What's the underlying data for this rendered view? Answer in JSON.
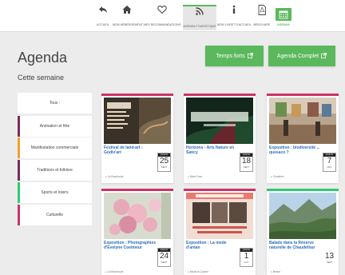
{
  "nav": {
    "items": [
      {
        "label": "ACCUEIL",
        "icon": "undo-arrow-icon"
      },
      {
        "label": "MON HÉBERGEMENT",
        "icon": "house-icon"
      },
      {
        "label": "MES RECOMMANDATIONS",
        "icon": "heart-icon"
      },
      {
        "label": "AGENDA TOURISTIQUE",
        "icon": "rss-icon"
      },
      {
        "label": "MON LIVRET D'ACCUEIL",
        "icon": "info-icon"
      },
      {
        "label": "BROCHURE",
        "icon": "pdf-icon"
      },
      {
        "label": "AGENDA",
        "icon": "calendar-icon"
      }
    ]
  },
  "page": {
    "title": "Agenda",
    "subtitle": "Cette semaine"
  },
  "buttons": {
    "temps_forts": "Temps forts",
    "agenda_complet": "Agenda Complet"
  },
  "sidebar": {
    "items": [
      {
        "label": "Tous :",
        "color": ""
      },
      {
        "label": "Animation et fête",
        "color": "#7b2d5b"
      },
      {
        "label": "Manifestation commerciale",
        "color": "#f0a030"
      },
      {
        "label": "Traditions et folklore",
        "color": "#7b2d5b"
      },
      {
        "label": "Sports et loisirs",
        "color": "#2ecc71"
      },
      {
        "label": "Culturelle",
        "color": "#cc3366"
      }
    ]
  },
  "cards": [
    {
      "title": "Festival de land-art : Godiv'art",
      "place": "La Bourboule",
      "date_top": "jusqu'au",
      "day": "25",
      "month": "SEPT",
      "image": "godivart-poster"
    },
    {
      "title": "Horizons - Arts Nature en Sancy",
      "place": "Mont-Dore",
      "date_top": "jusqu'au",
      "day": "18",
      "month": "SEPT",
      "image": "horizons-poster"
    },
    {
      "title": "Exposition : biodiversité ... quésaco ?",
      "place": "Chastreix",
      "date_top": "jusqu'au",
      "day": "7",
      "month": "NOV",
      "image": "exhibition-photo"
    },
    {
      "title": "Exposition : Photographies d'Evelyne Coetmeur",
      "place": "La Bourboule",
      "date_top": "jusqu'au",
      "day": "24",
      "month": "SEPT",
      "image": "flowers-photo"
    },
    {
      "title": "Exposition : La mode d'antan",
      "place": "Murat-le-Quaire",
      "date_top": "jusqu'au",
      "day": "1",
      "month": "OCT",
      "image": "mode-antan-poster"
    },
    {
      "title": "Balade dans la Réserve naturelle de Chaudefour",
      "place": "Besse",
      "date_top": "",
      "day": "13",
      "month": "SEPT",
      "image": "valley-photo"
    }
  ],
  "colors": {
    "accent": "#5cb85c",
    "link": "#2a6ebb",
    "card_stripe": "#cc3366"
  }
}
